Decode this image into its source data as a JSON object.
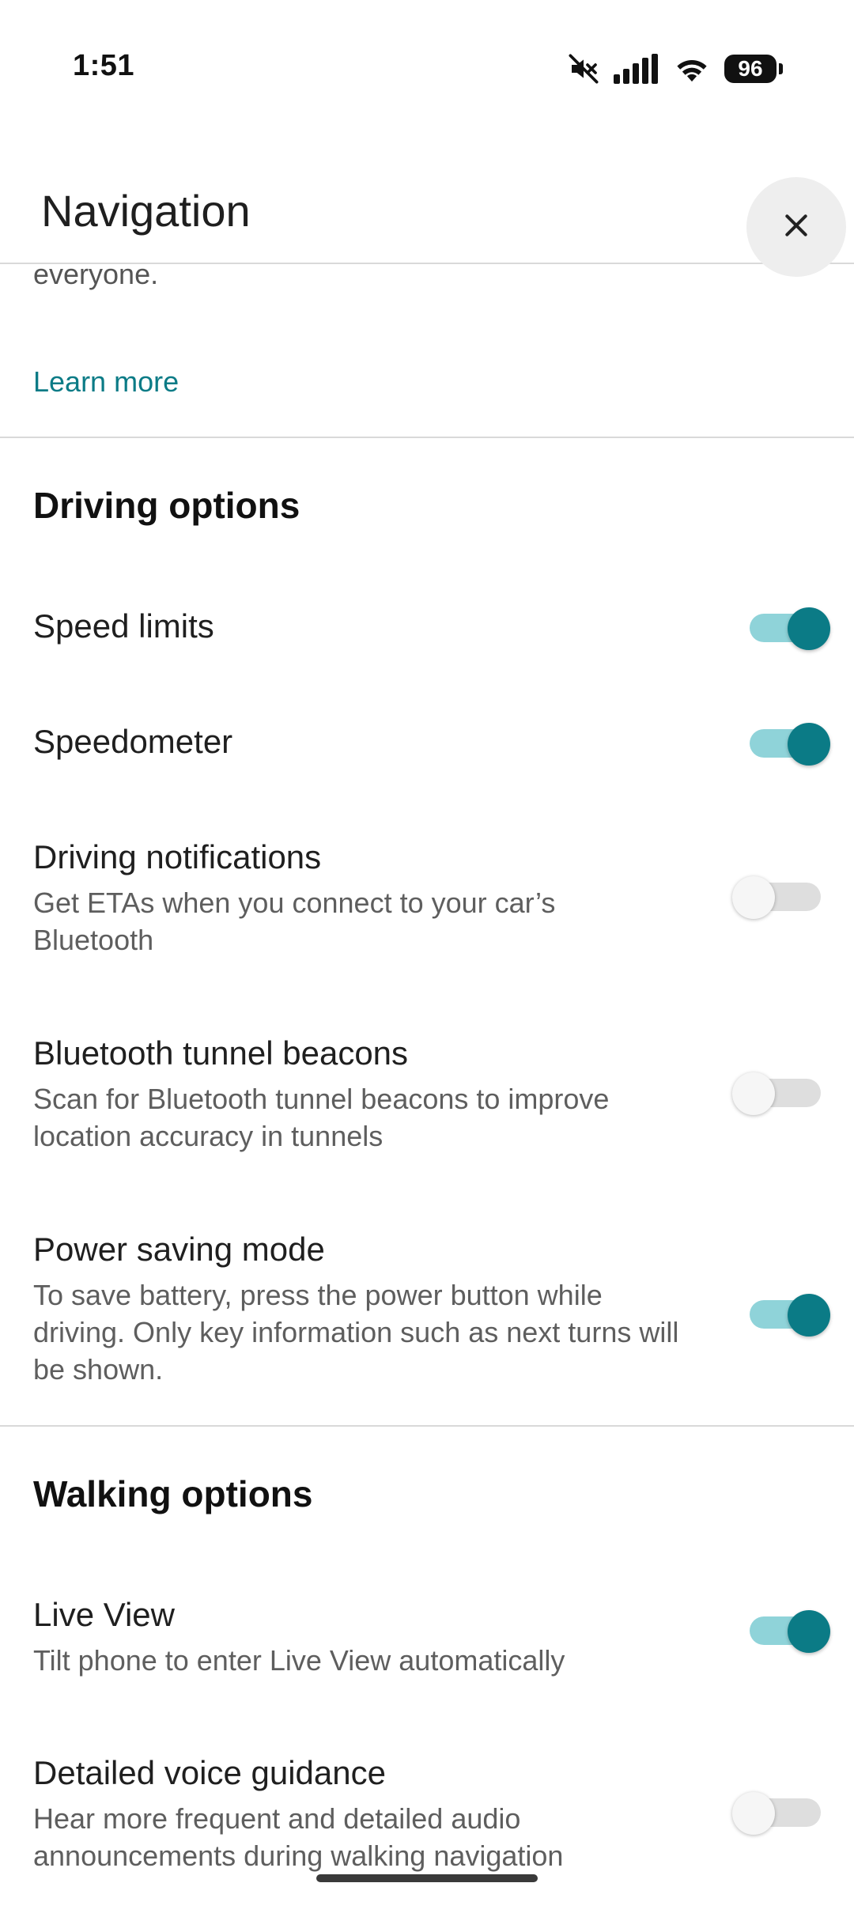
{
  "status_bar": {
    "time": "1:51",
    "battery": "96",
    "icons": [
      "mute-icon",
      "signal-icon",
      "wifi-icon",
      "battery-icon"
    ]
  },
  "header": {
    "title": "Navigation",
    "close_icon": "close-icon"
  },
  "top_fragment": {
    "cut_text": "everyone.",
    "learn_more": "Learn more"
  },
  "driving": {
    "title": "Driving options",
    "items": [
      {
        "title": "Speed limits",
        "desc": "",
        "enabled": true
      },
      {
        "title": "Speedometer",
        "desc": "",
        "enabled": true
      },
      {
        "title": "Driving notifications",
        "desc": "Get ETAs when you connect to your car’s Bluetooth",
        "enabled": false
      },
      {
        "title": "Bluetooth tunnel beacons",
        "desc": "Scan for Bluetooth tunnel beacons to improve location accuracy in tunnels",
        "enabled": false
      },
      {
        "title": "Power saving mode",
        "desc": "To save battery, press the power button while driving. Only key information such as next turns will be shown.",
        "enabled": true
      }
    ]
  },
  "walking": {
    "title": "Walking options",
    "items": [
      {
        "title": "Live View",
        "desc": "Tilt phone to enter Live View automatically",
        "enabled": true
      },
      {
        "title": "Detailed voice guidance",
        "desc": "Hear more frequent and detailed audio announcements during walking navigation",
        "enabled": false
      }
    ]
  },
  "colors": {
    "accent": "#0b7b86",
    "accent_track": "#8fd3d9",
    "link": "#0b7b86"
  }
}
